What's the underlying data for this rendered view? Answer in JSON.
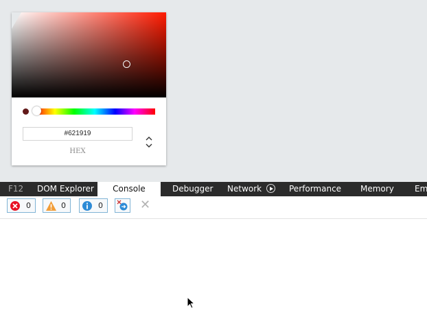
{
  "color_picker": {
    "hex_value": "#621919",
    "mode_label": "HEX",
    "selected_color": "#621919",
    "base_hue_color": "#ff1a00"
  },
  "devtools": {
    "tabs": [
      {
        "label": "F12"
      },
      {
        "label": "DOM Explorer"
      },
      {
        "label": "Console"
      },
      {
        "label": "Debugger"
      },
      {
        "label": "Network"
      },
      {
        "label": "Performance"
      },
      {
        "label": "Memory"
      },
      {
        "label": "Em"
      }
    ],
    "active_tab": "Console"
  },
  "console_toolbar": {
    "errors_count": "0",
    "warnings_count": "0",
    "info_count": "0"
  },
  "icons": {
    "error": "error-icon",
    "warning": "warning-icon",
    "info": "info-icon",
    "clear_on_navigate": "clear-on-navigate-icon",
    "close": "close-icon",
    "network_record": "play-icon"
  }
}
